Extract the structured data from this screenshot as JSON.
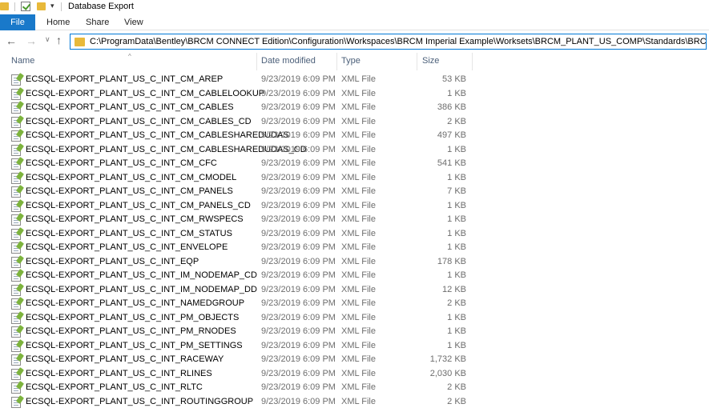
{
  "window": {
    "title": "Database Export"
  },
  "quick_access": {
    "dropdown_icon": "dropdown-arrow-icon"
  },
  "ribbon": {
    "tabs": [
      {
        "label": "File"
      },
      {
        "label": "Home"
      },
      {
        "label": "Share"
      },
      {
        "label": "View"
      }
    ]
  },
  "address": {
    "path": "C:\\ProgramData\\Bentley\\BRCM CONNECT Edition\\Configuration\\Workspaces\\BRCM Imperial Example\\Worksets\\BRCM_PLANT_US_COMP\\Standards\\BRCM\\Database Export"
  },
  "columns": {
    "name": "Name",
    "date": "Date modified",
    "type": "Type",
    "size": "Size"
  },
  "files": [
    {
      "name": "ECSQL-EXPORT_PLANT_US_C_INT_CM_AREP",
      "date": "9/23/2019 6:09 PM",
      "type": "XML File",
      "size": "53 KB"
    },
    {
      "name": "ECSQL-EXPORT_PLANT_US_C_INT_CM_CABLELOOKUP",
      "date": "9/23/2019 6:09 PM",
      "type": "XML File",
      "size": "1 KB"
    },
    {
      "name": "ECSQL-EXPORT_PLANT_US_C_INT_CM_CABLES",
      "date": "9/23/2019 6:09 PM",
      "type": "XML File",
      "size": "386 KB"
    },
    {
      "name": "ECSQL-EXPORT_PLANT_US_C_INT_CM_CABLES_CD",
      "date": "9/23/2019 6:09 PM",
      "type": "XML File",
      "size": "2 KB"
    },
    {
      "name": "ECSQL-EXPORT_PLANT_US_C_INT_CM_CABLESHAREDUDAS",
      "date": "9/23/2019 6:09 PM",
      "type": "XML File",
      "size": "497 KB"
    },
    {
      "name": "ECSQL-EXPORT_PLANT_US_C_INT_CM_CABLESHAREDUDAS_CD",
      "date": "9/23/2019 6:09 PM",
      "type": "XML File",
      "size": "1 KB"
    },
    {
      "name": "ECSQL-EXPORT_PLANT_US_C_INT_CM_CFC",
      "date": "9/23/2019 6:09 PM",
      "type": "XML File",
      "size": "541 KB"
    },
    {
      "name": "ECSQL-EXPORT_PLANT_US_C_INT_CM_CMODEL",
      "date": "9/23/2019 6:09 PM",
      "type": "XML File",
      "size": "1 KB"
    },
    {
      "name": "ECSQL-EXPORT_PLANT_US_C_INT_CM_PANELS",
      "date": "9/23/2019 6:09 PM",
      "type": "XML File",
      "size": "7 KB"
    },
    {
      "name": "ECSQL-EXPORT_PLANT_US_C_INT_CM_PANELS_CD",
      "date": "9/23/2019 6:09 PM",
      "type": "XML File",
      "size": "1 KB"
    },
    {
      "name": "ECSQL-EXPORT_PLANT_US_C_INT_CM_RWSPECS",
      "date": "9/23/2019 6:09 PM",
      "type": "XML File",
      "size": "1 KB"
    },
    {
      "name": "ECSQL-EXPORT_PLANT_US_C_INT_CM_STATUS",
      "date": "9/23/2019 6:09 PM",
      "type": "XML File",
      "size": "1 KB"
    },
    {
      "name": "ECSQL-EXPORT_PLANT_US_C_INT_ENVELOPE",
      "date": "9/23/2019 6:09 PM",
      "type": "XML File",
      "size": "1 KB"
    },
    {
      "name": "ECSQL-EXPORT_PLANT_US_C_INT_EQP",
      "date": "9/23/2019 6:09 PM",
      "type": "XML File",
      "size": "178 KB"
    },
    {
      "name": "ECSQL-EXPORT_PLANT_US_C_INT_IM_NODEMAP_CD",
      "date": "9/23/2019 6:09 PM",
      "type": "XML File",
      "size": "1 KB"
    },
    {
      "name": "ECSQL-EXPORT_PLANT_US_C_INT_IM_NODEMAP_DD",
      "date": "9/23/2019 6:09 PM",
      "type": "XML File",
      "size": "12 KB"
    },
    {
      "name": "ECSQL-EXPORT_PLANT_US_C_INT_NAMEDGROUP",
      "date": "9/23/2019 6:09 PM",
      "type": "XML File",
      "size": "2 KB"
    },
    {
      "name": "ECSQL-EXPORT_PLANT_US_C_INT_PM_OBJECTS",
      "date": "9/23/2019 6:09 PM",
      "type": "XML File",
      "size": "1 KB"
    },
    {
      "name": "ECSQL-EXPORT_PLANT_US_C_INT_PM_RNODES",
      "date": "9/23/2019 6:09 PM",
      "type": "XML File",
      "size": "1 KB"
    },
    {
      "name": "ECSQL-EXPORT_PLANT_US_C_INT_PM_SETTINGS",
      "date": "9/23/2019 6:09 PM",
      "type": "XML File",
      "size": "1 KB"
    },
    {
      "name": "ECSQL-EXPORT_PLANT_US_C_INT_RACEWAY",
      "date": "9/23/2019 6:09 PM",
      "type": "XML File",
      "size": "1,732 KB"
    },
    {
      "name": "ECSQL-EXPORT_PLANT_US_C_INT_RLINES",
      "date": "9/23/2019 6:09 PM",
      "type": "XML File",
      "size": "2,030 KB"
    },
    {
      "name": "ECSQL-EXPORT_PLANT_US_C_INT_RLTC",
      "date": "9/23/2019 6:09 PM",
      "type": "XML File",
      "size": "2 KB"
    },
    {
      "name": "ECSQL-EXPORT_PLANT_US_C_INT_ROUTINGGROUP",
      "date": "9/23/2019 6:09 PM",
      "type": "XML File",
      "size": "2 KB"
    }
  ]
}
